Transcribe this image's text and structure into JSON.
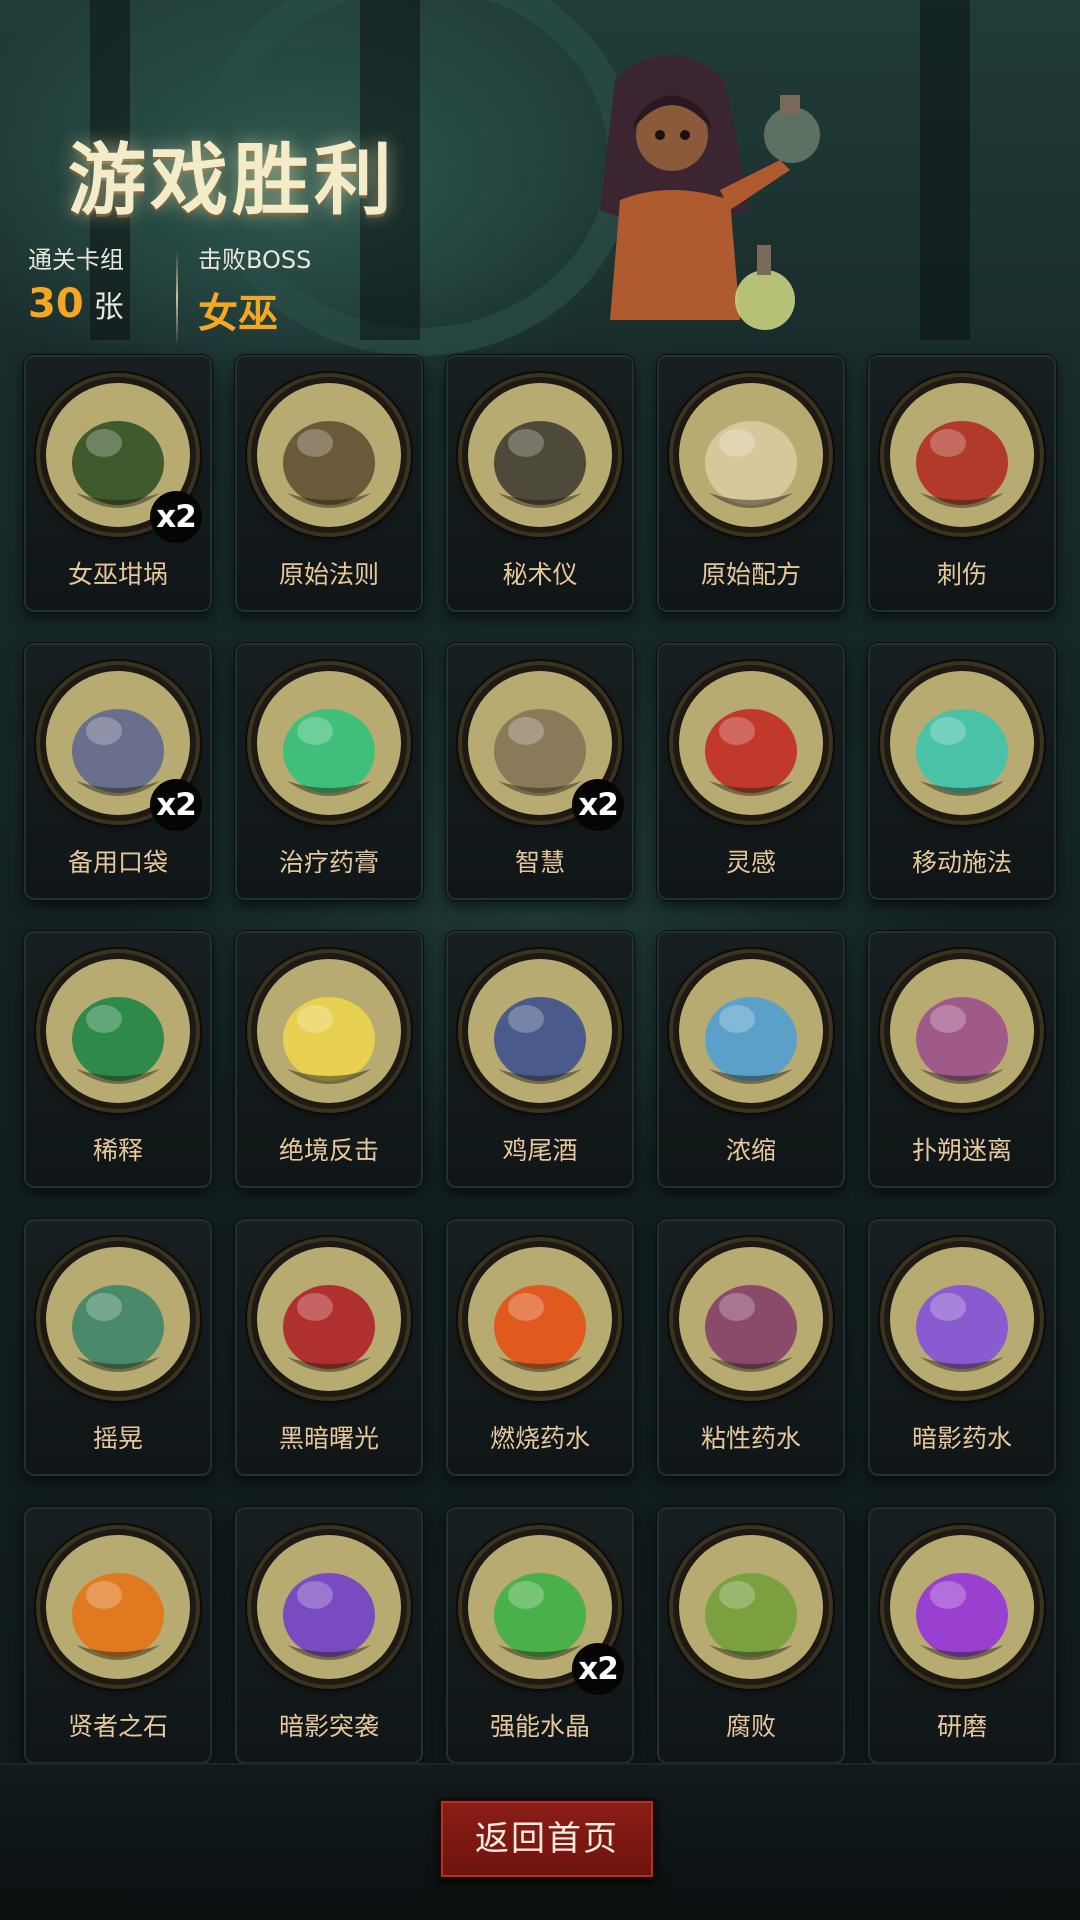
{
  "header": {
    "title": "游戏胜利",
    "cleared_deck_label": "通关卡组",
    "cleared_deck_count": "30",
    "cleared_deck_unit": "张",
    "boss_label": "击败BOSS",
    "boss_name": "女巫"
  },
  "cards": [
    {
      "name": "女巫坩埚",
      "icon": "cauldron-icon",
      "count": "x2",
      "color": "#3f5a2c"
    },
    {
      "name": "原始法则",
      "icon": "scales-icon",
      "count": "",
      "color": "#6b5a3a"
    },
    {
      "name": "秘术仪",
      "icon": "ritual-altar-icon",
      "count": "",
      "color": "#4d4a3a"
    },
    {
      "name": "原始配方",
      "icon": "scroll-icon",
      "count": "",
      "color": "#d8c79a"
    },
    {
      "name": "刺伤",
      "icon": "dagger-icon",
      "count": "",
      "color": "#b23a2a"
    },
    {
      "name": "备用口袋",
      "icon": "hand-pocket-icon",
      "count": "x2",
      "color": "#6a6f8c"
    },
    {
      "name": "治疗药膏",
      "icon": "ointment-tube-icon",
      "count": "",
      "color": "#3fbf7a"
    },
    {
      "name": "智慧",
      "icon": "sage-icon",
      "count": "x2",
      "color": "#8a7a5a"
    },
    {
      "name": "灵感",
      "icon": "skull-brain-icon",
      "count": "",
      "color": "#c0392b"
    },
    {
      "name": "移动施法",
      "icon": "wizard-icon",
      "count": "",
      "color": "#49c2a8"
    },
    {
      "name": "稀释",
      "icon": "witch-brew-icon",
      "count": "",
      "color": "#2e8a4a"
    },
    {
      "name": "绝境反击",
      "icon": "warrior-icon",
      "count": "",
      "color": "#e8d050"
    },
    {
      "name": "鸡尾酒",
      "icon": "cocktail-icon",
      "count": "",
      "color": "#4a5a8a"
    },
    {
      "name": "浓缩",
      "icon": "alchemy-flask-icon",
      "count": "",
      "color": "#5aa0c8"
    },
    {
      "name": "扑朔迷离",
      "icon": "mystery-sphere-icon",
      "count": "",
      "color": "#a05a8a"
    },
    {
      "name": "摇晃",
      "icon": "scientist-icon",
      "count": "",
      "color": "#4a8a6a"
    },
    {
      "name": "黑暗曙光",
      "icon": "demon-icon",
      "count": "",
      "color": "#b03030"
    },
    {
      "name": "燃烧药水",
      "icon": "fire-potion-icon",
      "count": "",
      "color": "#e05a20"
    },
    {
      "name": "粘性药水",
      "icon": "alchemist-icon",
      "count": "",
      "color": "#8a4a6a"
    },
    {
      "name": "暗影药水",
      "icon": "reaper-potion-icon",
      "count": "",
      "color": "#8a5ad0"
    },
    {
      "name": "贤者之石",
      "icon": "philosopher-stone-icon",
      "count": "",
      "color": "#e07a20"
    },
    {
      "name": "暗影突袭",
      "icon": "reaper-icon",
      "count": "",
      "color": "#7a4ac0"
    },
    {
      "name": "强能水晶",
      "icon": "crystal-gyroscope-icon",
      "count": "x2",
      "color": "#4ab04a"
    },
    {
      "name": "腐败",
      "icon": "carcass-icon",
      "count": "",
      "color": "#7aa040"
    },
    {
      "name": "研磨",
      "icon": "grinder-icon",
      "count": "",
      "color": "#9a40d0"
    }
  ],
  "footer": {
    "home_button_label": "返回首页"
  },
  "colors": {
    "accent_orange": "#f5a623",
    "card_label": "#e6c79c",
    "button_red": "#8c1d16",
    "icon_background": "#b8ab72"
  }
}
